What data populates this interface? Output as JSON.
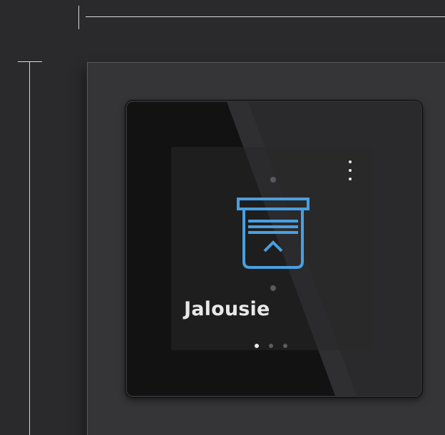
{
  "device": {
    "title": "Jalousie",
    "icon": "window-blind-icon",
    "menu_icon": "more-vertical-icon",
    "page_dots": [
      {
        "active": true
      },
      {
        "active": false
      },
      {
        "active": false
      }
    ],
    "colors": {
      "accent": "#4a9fe0",
      "title": "#e9e9e9",
      "background": "#2a2a2c",
      "glass": "#121213"
    }
  }
}
